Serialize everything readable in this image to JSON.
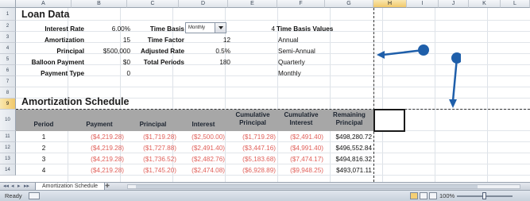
{
  "columns": [
    "A",
    "B",
    "C",
    "D",
    "E",
    "F",
    "G",
    "H",
    "I",
    "J",
    "K",
    "L"
  ],
  "selected_column": "H",
  "rows": [
    "1",
    "2",
    "3",
    "4",
    "5",
    "6",
    "7",
    "8",
    "9",
    "10",
    "11",
    "12",
    "13",
    "14"
  ],
  "selected_row": "9",
  "loan_data": {
    "title": "Loan Data",
    "fields": [
      {
        "label": "Interest Rate",
        "value": "6.00%"
      },
      {
        "label": "Amortization",
        "value": "15"
      },
      {
        "label": "Principal",
        "value": "$500,000"
      },
      {
        "label": "Balloon Payment",
        "value": "$0"
      },
      {
        "label": "Payment Type",
        "value": "0"
      }
    ],
    "right_fields": [
      {
        "label": "Time Basis",
        "value": ""
      },
      {
        "label": "Time Factor",
        "value": "12"
      },
      {
        "label": "Adjusted Rate",
        "value": "0.5%"
      },
      {
        "label": "Total Periods",
        "value": "180"
      }
    ],
    "time_basis_selected": "Monthly",
    "time_basis_count": "4",
    "time_basis_values_title": "Time Basis Values",
    "time_basis_values": [
      "Annual",
      "Semi-Annual",
      "Quarterly",
      "Monthly"
    ]
  },
  "amortization": {
    "title": "Amortization Schedule",
    "headers": [
      {
        "line1": "",
        "line2": "Period"
      },
      {
        "line1": "",
        "line2": "Payment"
      },
      {
        "line1": "",
        "line2": "Principal"
      },
      {
        "line1": "",
        "line2": "Interest"
      },
      {
        "line1": "Cumulative",
        "line2": "Principal"
      },
      {
        "line1": "Cumulative",
        "line2": "Interest"
      },
      {
        "line1": "Remaining",
        "line2": "Principal"
      }
    ],
    "rows": [
      {
        "period": "1",
        "payment": "($4,219.28)",
        "principal": "($1,719.28)",
        "interest": "($2,500.00)",
        "cum_principal": "($1,719.28)",
        "cum_interest": "($2,491.40)",
        "remaining": "$498,280.72"
      },
      {
        "period": "2",
        "payment": "($4,219.28)",
        "principal": "($1,727.88)",
        "interest": "($2,491.40)",
        "cum_principal": "($3,447.16)",
        "cum_interest": "($4,991.40)",
        "remaining": "$496,552.84"
      },
      {
        "period": "3",
        "payment": "($4,219.28)",
        "principal": "($1,736.52)",
        "interest": "($2,482.76)",
        "cum_principal": "($5,183.68)",
        "cum_interest": "($7,474.17)",
        "remaining": "$494,816.32"
      },
      {
        "period": "4",
        "payment": "($4,219.28)",
        "principal": "($1,745.20)",
        "interest": "($2,474.08)",
        "cum_principal": "($6,928.89)",
        "cum_interest": "($9,948.25)",
        "remaining": "$493,071.11"
      }
    ]
  },
  "sheet_tab": "Amortization Schedule",
  "status": {
    "ready": "Ready",
    "zoom": "100%"
  }
}
